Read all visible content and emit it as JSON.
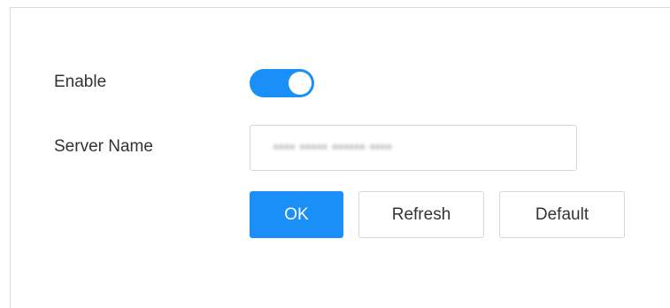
{
  "form": {
    "enable_label": "Enable",
    "enable_toggle": {
      "state": "on"
    },
    "server_name_label": "Server Name",
    "server_name_value": "•••• ••••• •••••• ••••",
    "ok_label": "OK",
    "refresh_label": "Refresh",
    "default_label": "Default"
  },
  "colors": {
    "accent": "#1a8ff7",
    "text": "#333333",
    "border": "#d6d6d6"
  }
}
